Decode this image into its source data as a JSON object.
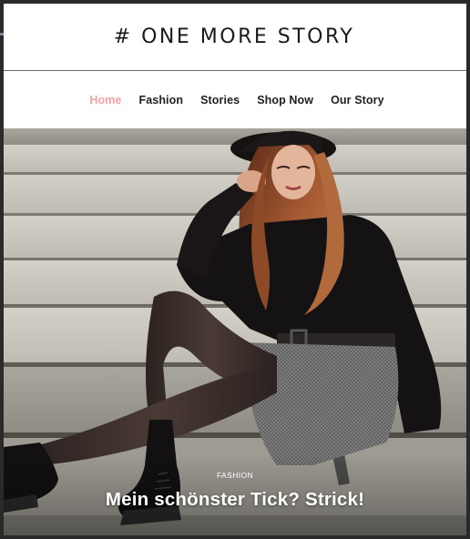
{
  "header": {
    "logo": "# ONE MORE STORY"
  },
  "nav": {
    "items": [
      {
        "label": "Home",
        "active": true
      },
      {
        "label": "Fashion",
        "active": false
      },
      {
        "label": "Stories",
        "active": false
      },
      {
        "label": "Shop Now",
        "active": false
      },
      {
        "label": "Our Story",
        "active": false
      }
    ]
  },
  "hero": {
    "category": "FASHION",
    "title": "Mein schönster Tick? Strick!"
  },
  "colors": {
    "accent": "#f2a3a0",
    "text": "#1f1f1f",
    "divider": "#6b6b6b"
  }
}
